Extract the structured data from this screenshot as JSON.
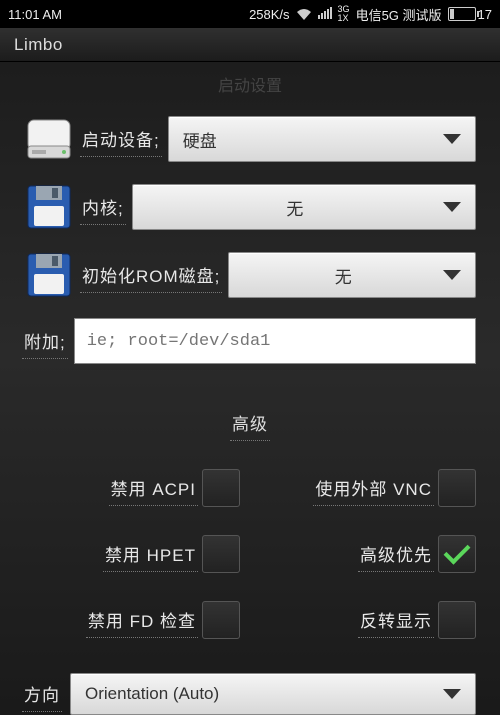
{
  "statusbar": {
    "time": "11:01 AM",
    "speed": "258K/s",
    "network_top": "3G",
    "network_bottom": "1X",
    "carrier": "电信5G 测试版",
    "battery": "17"
  },
  "appbar": {
    "title": "Limbo"
  },
  "faded_heading": "启动设置",
  "rows": {
    "boot_device": {
      "label": "启动设备;",
      "value": "硬盘"
    },
    "kernel": {
      "label": "内核;",
      "value": "无"
    },
    "initrd": {
      "label": "初始化ROM磁盘;",
      "value": "无"
    },
    "append": {
      "label": "附加;",
      "placeholder": "ie; root=/dev/sda1"
    }
  },
  "advanced": {
    "title": "高级",
    "disable_acpi": "禁用 ACPI",
    "external_vnc": "使用外部 VNC",
    "disable_hpet": "禁用 HPET",
    "high_priority": "高级优先",
    "disable_fd": "禁用 FD 检查",
    "reverse_display": "反转显示"
  },
  "orientation": {
    "label": "方向",
    "value": "Orientation (Auto)"
  }
}
